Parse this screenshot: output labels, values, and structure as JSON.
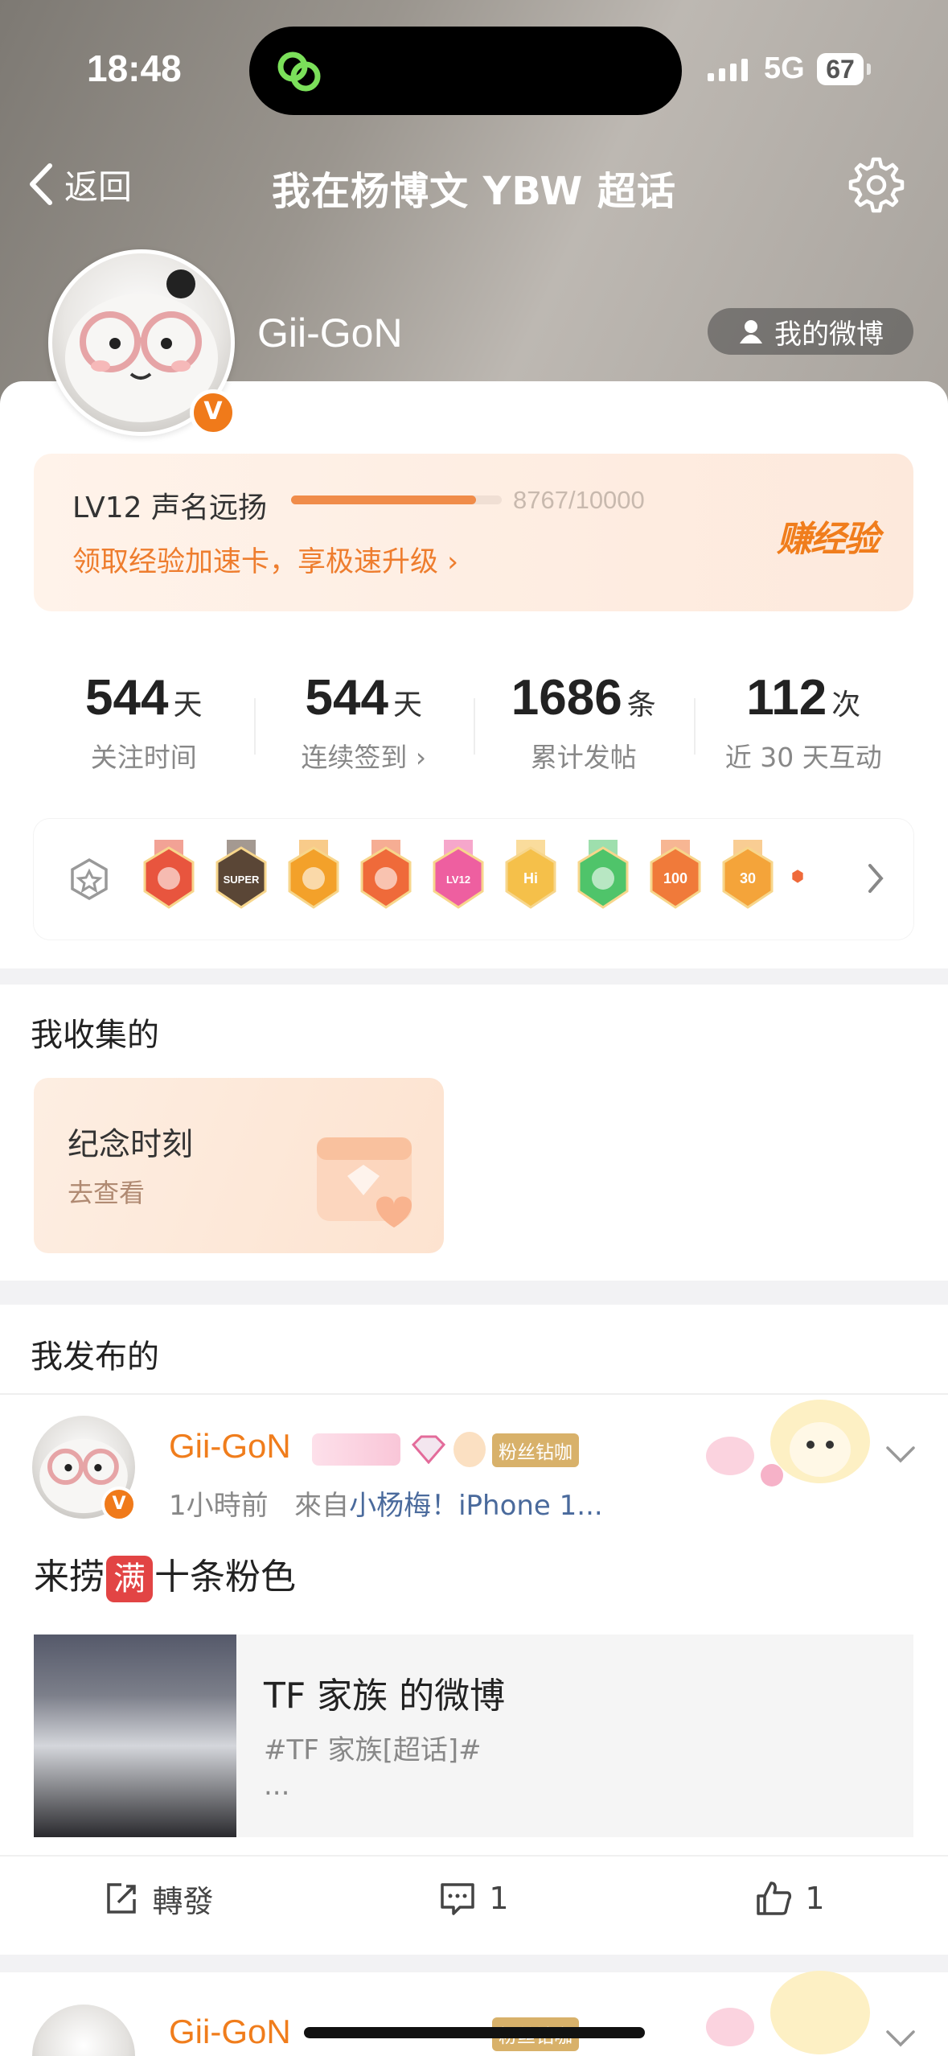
{
  "status_bar": {
    "time": "18:48",
    "network": "5G",
    "battery": "67"
  },
  "nav": {
    "back_label": "返回",
    "title": "我在杨博文 YBW 超话"
  },
  "profile": {
    "username": "Gii-GoN",
    "my_weibo_label": "我的微博",
    "verified_badge": "V"
  },
  "level": {
    "label": "LV12 声名远扬",
    "progress_text": "8767/10000",
    "progress": 0.8767,
    "promo_link": "领取经验加速卡，享极速升级",
    "earn_label": "赚经验"
  },
  "stats": [
    {
      "value": "544",
      "unit": "天",
      "label": "关注时间"
    },
    {
      "value": "544",
      "unit": "天",
      "label": "连续签到 ›"
    },
    {
      "value": "1686",
      "unit": "条",
      "label": "累计发帖"
    },
    {
      "value": "112",
      "unit": "次",
      "label": "近 30 天互动"
    }
  ],
  "medals": {
    "items": [
      {
        "name": "medal-red",
        "color": "#e8553e"
      },
      {
        "name": "medal-super",
        "color": "#5a4636",
        "text": "SUPER"
      },
      {
        "name": "medal-crown",
        "color": "#f3a12a"
      },
      {
        "name": "medal-fox",
        "color": "#ef6a3a"
      },
      {
        "name": "medal-lv12",
        "color": "#ee5fa0",
        "text": "LV12"
      },
      {
        "name": "medal-hi",
        "color": "#f5c04a",
        "text": "Hi"
      },
      {
        "name": "medal-hand",
        "color": "#4fc46a"
      },
      {
        "name": "medal-100days",
        "color": "#f07a3a",
        "text": "100"
      },
      {
        "name": "medal-30days",
        "color": "#f4a43a",
        "text": "30"
      }
    ]
  },
  "collected": {
    "title": "我收集的",
    "card_title": "纪念时刻",
    "card_sub": "去查看"
  },
  "published": {
    "title": "我发布的"
  },
  "post": {
    "author": "Gii-GoN",
    "fan_tag": "粉丝钻咖",
    "time": "1小時前",
    "from_prefix": "來自",
    "source": "小杨梅！iPhone 1...",
    "text_before": "来捞",
    "text_chip": "满",
    "text_after": "十条粉色",
    "repost_title": "TF 家族 的微博",
    "repost_tag": "#TF 家族[超话]#",
    "repost_more": "...",
    "repost_label": "轉發",
    "comments": "1",
    "likes": "1"
  },
  "post2": {
    "author": "Gii-GoN",
    "fan_tag": "粉丝钻咖"
  },
  "colors": {
    "accent": "#f07d1c",
    "link": "#4a6a9c"
  }
}
